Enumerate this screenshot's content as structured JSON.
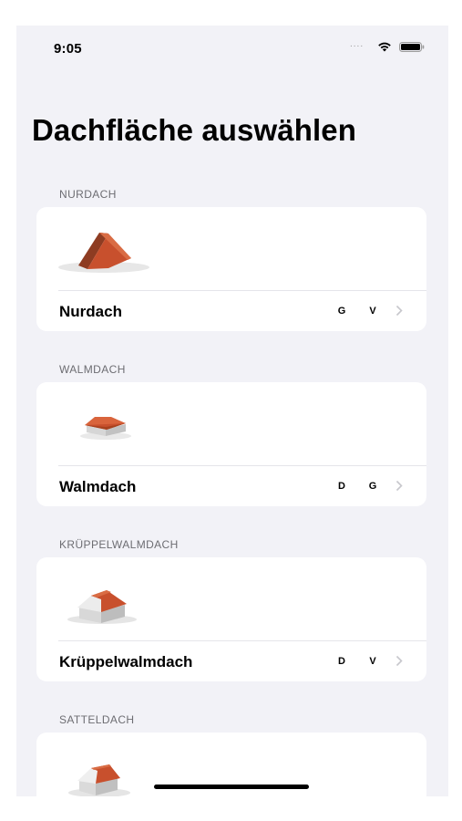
{
  "status_bar": {
    "time": "9:05",
    "signal": "....",
    "wifi_icon": "wifi-icon",
    "battery_icon": "battery-icon"
  },
  "page": {
    "title": "Dachfläche auswählen"
  },
  "sections": [
    {
      "header": "NURDACH",
      "item": {
        "label": "Nurdach",
        "badges": [
          "G",
          "V"
        ],
        "image": "nurdach-roof-image"
      }
    },
    {
      "header": "WALMDACH",
      "item": {
        "label": "Walmdach",
        "badges": [
          "D",
          "G"
        ],
        "image": "walmdach-roof-image"
      }
    },
    {
      "header": "KRÜPPELWALMDACH",
      "item": {
        "label": "Krüppelwalmdach",
        "badges": [
          "D",
          "V"
        ],
        "image": "krueppelwalmdach-roof-image"
      }
    },
    {
      "header": "SATTELDACH",
      "item": {
        "label": "",
        "badges": [],
        "image": "satteldach-roof-image"
      }
    }
  ],
  "colors": {
    "background": "#f2f2f7",
    "card": "#ffffff",
    "roof": "#c8502d",
    "chevron": "#c7c7cc",
    "section_header": "#6d6d72"
  }
}
